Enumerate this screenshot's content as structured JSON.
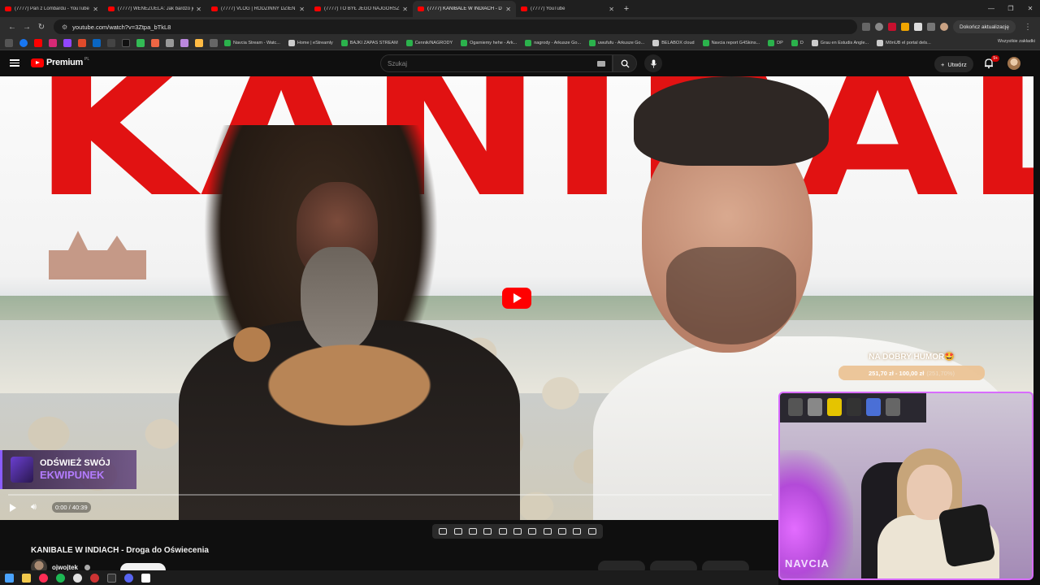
{
  "browser": {
    "tabs": [
      {
        "title": "(7777) Pan z Lombardu - YouTube",
        "active": false
      },
      {
        "title": "(7777) WENEZUELA: Jak bardzo je",
        "active": false
      },
      {
        "title": "(7777) VLOG | RODZINNY DZIEŃ",
        "active": false
      },
      {
        "title": "(7777) TO BYŁ JEGO NAJGORSZY",
        "active": false
      },
      {
        "title": "(7777) KANIBALE W INDIACH - D",
        "active": true
      },
      {
        "title": "(7777) YouTube",
        "active": false
      }
    ],
    "url": "youtube.com/watch?v=3Ztpa_bTkL8",
    "update_label": "Dokończ aktualizację",
    "bookmarks": [
      "Navcia Stream - Watc...",
      "Home | eStreamly",
      "BAJKI ZAPAS STREAM",
      "Cennik/NAGRODY",
      "Ogarniemy hehe - Ark...",
      "nagrody - Arkusze Go...",
      "uwufufu - Arkusze Go...",
      "BELABOX cloud",
      "Navcia report G4Skins...",
      "DP",
      "D",
      "Grau en Estudis Angle...",
      "MônUB el portal dels..."
    ],
    "all_bookmarks_label": "Wszystkie zakładki"
  },
  "youtube": {
    "logo_text": "Premium",
    "region": "PL",
    "search_placeholder": "Szukaj",
    "create_label": "Utwórz",
    "notifications_badge": "9+",
    "video_title": "KANIBALE W INDIACH - Droga do Oświecenia",
    "channel_name": "ojwojtek",
    "time_display": "0:00 / 40:39",
    "progress": 0
  },
  "overlay": {
    "promo_line1": "ODŚWIEŻ SWÓJ",
    "promo_line2": "EKWIPUNEK",
    "goal_title": "NA DOBRY HUMOR🤩",
    "goal_amount": "251,70 zł - 100,00 zł",
    "goal_percent": "(251,70%)",
    "goal_fill": 1.0,
    "webcam_tag": "NAVCIA"
  },
  "thumbnail_text": "KANIBALE",
  "colors": {
    "accent": "#ff0000",
    "overlay_purple": "#b47cff",
    "webcam_border": "#d86cff"
  }
}
